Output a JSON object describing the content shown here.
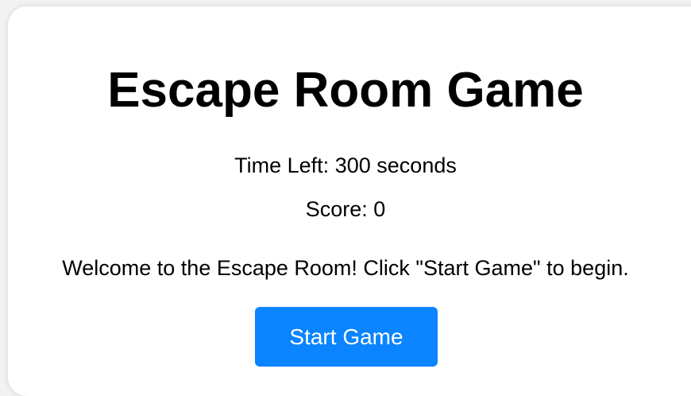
{
  "game": {
    "title": "Escape Room Game",
    "time_label": "Time Left:",
    "time_value": "300",
    "time_unit": "seconds",
    "score_label": "Score:",
    "score_value": "0",
    "message": "Welcome to the Escape Room! Click \"Start Game\" to begin.",
    "start_label": "Start Game"
  },
  "colors": {
    "accent": "#0a84ff",
    "background": "#ffffff",
    "text": "#000000"
  }
}
